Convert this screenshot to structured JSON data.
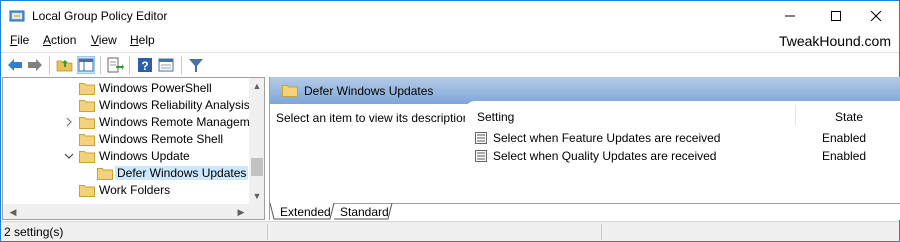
{
  "window": {
    "title": "Local Group Policy Editor"
  },
  "menu": {
    "file": "File",
    "file_rest": "ile",
    "file_key": "F",
    "action_key": "A",
    "action_rest": "ction",
    "view_key": "V",
    "view_rest": "iew",
    "help_key": "H",
    "help_rest": "elp",
    "brand": "TweakHound.com"
  },
  "toolbar": {
    "icons": [
      "back-arrow-icon",
      "forward-arrow-icon",
      "up-folder-icon",
      "show-hide-console-tree-icon",
      "export-list-icon",
      "help-icon",
      "properties-icon",
      "filter-icon"
    ]
  },
  "tree": {
    "items": [
      {
        "label": "Windows PowerShell",
        "expandable": false
      },
      {
        "label": "Windows Reliability Analysis",
        "expandable": false
      },
      {
        "label": "Windows Remote Managemer",
        "expandable": true,
        "expanded": false
      },
      {
        "label": "Windows Remote Shell",
        "expandable": false
      },
      {
        "label": "Windows Update",
        "expandable": true,
        "expanded": true
      },
      {
        "label": "Defer Windows Updates",
        "expandable": false,
        "selected": true
      },
      {
        "label": "Work Folders",
        "expandable": false
      }
    ]
  },
  "right": {
    "header_title": "Defer Windows Updates",
    "description": "Select an item to view its description.",
    "columns": {
      "setting": "Setting",
      "state": "State"
    },
    "rows": [
      {
        "name": "Select when Feature Updates are received",
        "state": "Enabled"
      },
      {
        "name": "Select when Quality Updates are received",
        "state": "Enabled"
      }
    ],
    "tabs": {
      "extended": "Extended",
      "standard": "Standard"
    }
  },
  "status": {
    "text": "2 setting(s)"
  },
  "colors": {
    "accent": "#1883d7",
    "header_gradient": "#7ea6d8",
    "selection": "#cce8ff",
    "folder": "#e8c15a"
  }
}
